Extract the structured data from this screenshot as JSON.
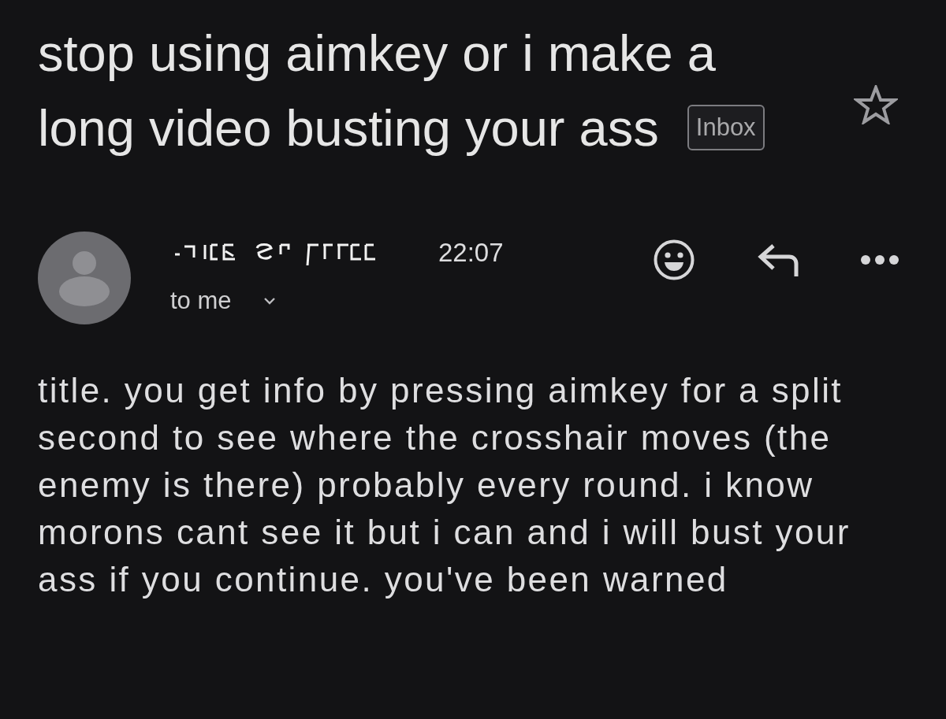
{
  "subject": "stop using aimkey or i make a long video busting your ass",
  "label_badge": "Inbox",
  "starred": false,
  "sender": {
    "time": "22:07",
    "recipient": "to me"
  },
  "body": "title. you get info by pressing aimkey for a split second to see where the crosshair moves (the enemy is there) probably every round. i know morons cant see it but i can and i will bust your ass if you continue. you've been warned"
}
